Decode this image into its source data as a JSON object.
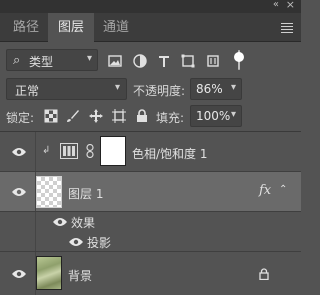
{
  "panel": {
    "tabs": [
      {
        "label": "路径",
        "active": false
      },
      {
        "label": "图层",
        "active": true
      },
      {
        "label": "通道",
        "active": false
      }
    ],
    "collapse_glyph": "«",
    "close_glyph": "×"
  },
  "filter": {
    "label": "类型",
    "icons": [
      "image-filter-icon",
      "adjustment-filter-icon",
      "text-filter-icon",
      "shape-filter-icon",
      "smart-object-filter-icon",
      "filter-toggle-icon"
    ]
  },
  "blend": {
    "mode": "正常",
    "opacity_label": "不透明度:",
    "opacity_value": "86%"
  },
  "lock": {
    "label": "锁定:",
    "icons": [
      "lock-transparent-icon",
      "lock-paint-icon",
      "lock-move-icon",
      "lock-artboard-icon",
      "lock-all-icon"
    ],
    "fill_label": "填充:",
    "fill_value": "100%"
  },
  "layers": [
    {
      "name": "色相/饱和度 1",
      "type": "adjustment",
      "visible": true,
      "clipped": true
    },
    {
      "name": "图层 1",
      "type": "pixel",
      "visible": true,
      "selected": true,
      "fx": "fx"
    },
    {
      "name": "效果",
      "type": "effects-group",
      "visible": true
    },
    {
      "name": "投影",
      "type": "effect",
      "visible": true
    },
    {
      "name": "背景",
      "type": "background",
      "visible": true,
      "locked": true
    }
  ],
  "colors": {
    "panel_bg": "#535353",
    "selected_row": "#6a6a6a",
    "tab_bar": "#3c3c3c"
  }
}
